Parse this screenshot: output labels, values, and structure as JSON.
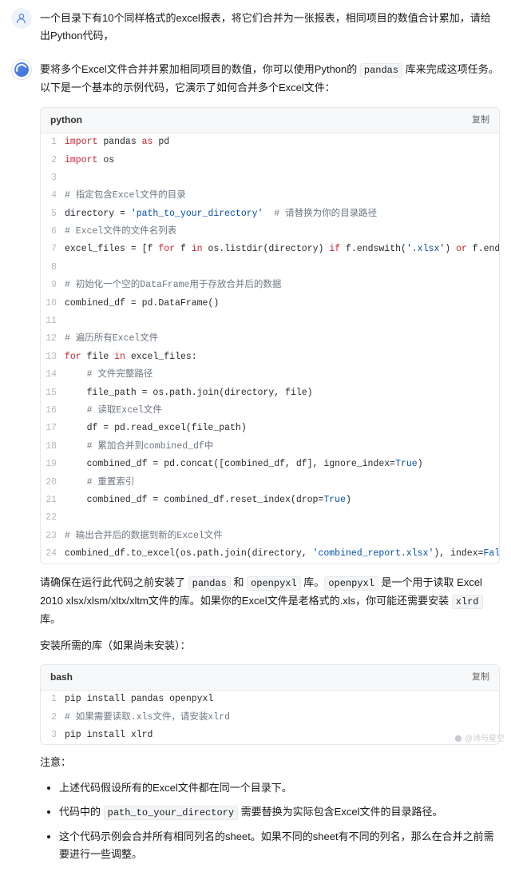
{
  "user": {
    "text": "一个目录下有10个同样格式的excel报表，将它们合并为一张报表，相同项目的数值合计累加，请给出Python代码，"
  },
  "bot": {
    "intro_before": "要将多个Excel文件合并并累加相同项目的数值，你可以使用Python的 ",
    "intro_code": "pandas",
    "intro_after": " 库来完成这项任务。以下是一个基本的示例代码，它演示了如何合并多个Excel文件：",
    "code1": {
      "lang": "python",
      "copy": "复制"
    },
    "install_p1": "请确保在运行此代码之前安装了 ",
    "install_c1": "pandas",
    "install_p2": " 和 ",
    "install_c2": "openpyxl",
    "install_p3": " 库。",
    "install_c3": "openpyxl",
    "install_p4": " 是一个用于读取 Excel 2010 xlsx/xlsm/xltx/xltm文件的库。如果你的Excel文件是老格式的.xls，你可能还需要安装 ",
    "install_c4": "xlrd",
    "install_p5": " 库。",
    "install_title": "安装所需的库（如果尚未安装）：",
    "code2": {
      "lang": "bash",
      "copy": "复制",
      "l1": "pip install pandas openpyxl",
      "l2": "# 如果需要读取.xls文件，请安装xlrd",
      "l3": "pip install xlrd"
    },
    "notes_title": "注意：",
    "notes": {
      "n1": "上述代码假设所有的Excel文件都在同一个目录下。",
      "n2_a": "代码中的 ",
      "n2_code": "path_to_your_directory",
      "n2_b": " 需要替换为实际包含Excel文件的目录路径。",
      "n3": "这个代码示例会合并所有相同列名的sheet。如果不同的sheet有不同的列名，那么在合并之前需要进行一些调整。"
    }
  },
  "py": {
    "l1_import": "import",
    "l1_pandas": " pandas ",
    "l1_as": "as",
    "l1_pd": " pd",
    "l2_import": "import",
    "l2_os": " os",
    "l4": "# 指定包含Excel文件的目录",
    "l5_a": "directory = ",
    "l5_s": "'path_to_your_directory'",
    "l5_c": "  # 请替换为你的目录路径",
    "l6": "# Excel文件的文件名列表",
    "l7_a": "excel_files = [f ",
    "l7_for": "for",
    "l7_b": " f ",
    "l7_in": "in",
    "l7_c": " os.listdir(directory) ",
    "l7_if": "if",
    "l7_d": " f.endswith(",
    "l7_s1": "'.xlsx'",
    "l7_e": ") ",
    "l7_or": "or",
    "l7_f": " f.endswith(",
    "l9": "# 初始化一个空的DataFrame用于存放合并后的数据",
    "l10": "combined_df = pd.DataFrame()",
    "l12": "# 遍历所有Excel文件",
    "l13_for": "for",
    "l13_a": " file ",
    "l13_in": "in",
    "l13_b": " excel_files:",
    "l14": "    # 文件完整路径",
    "l15": "    file_path = os.path.join(directory, file)",
    "l16": "    # 读取Excel文件",
    "l17": "    df = pd.read_excel(file_path)",
    "l18": "    # 累加合并到combined_df中",
    "l19_a": "    combined_df = pd.concat([combined_df, df], ignore_index=",
    "l19_t": "True",
    "l19_b": ")",
    "l20": "    # 重置索引",
    "l21_a": "    combined_df = combined_df.reset_index(drop=",
    "l21_t": "True",
    "l21_b": ")",
    "l23": "# 输出合并后的数据到新的Excel文件",
    "l24_a": "combined_df.to_excel(os.path.join(directory, ",
    "l24_s": "'combined_report.xlsx'",
    "l24_b": "), index=",
    "l24_f": "False",
    "l24_c": ")"
  },
  "watermark": "@诗与星空"
}
